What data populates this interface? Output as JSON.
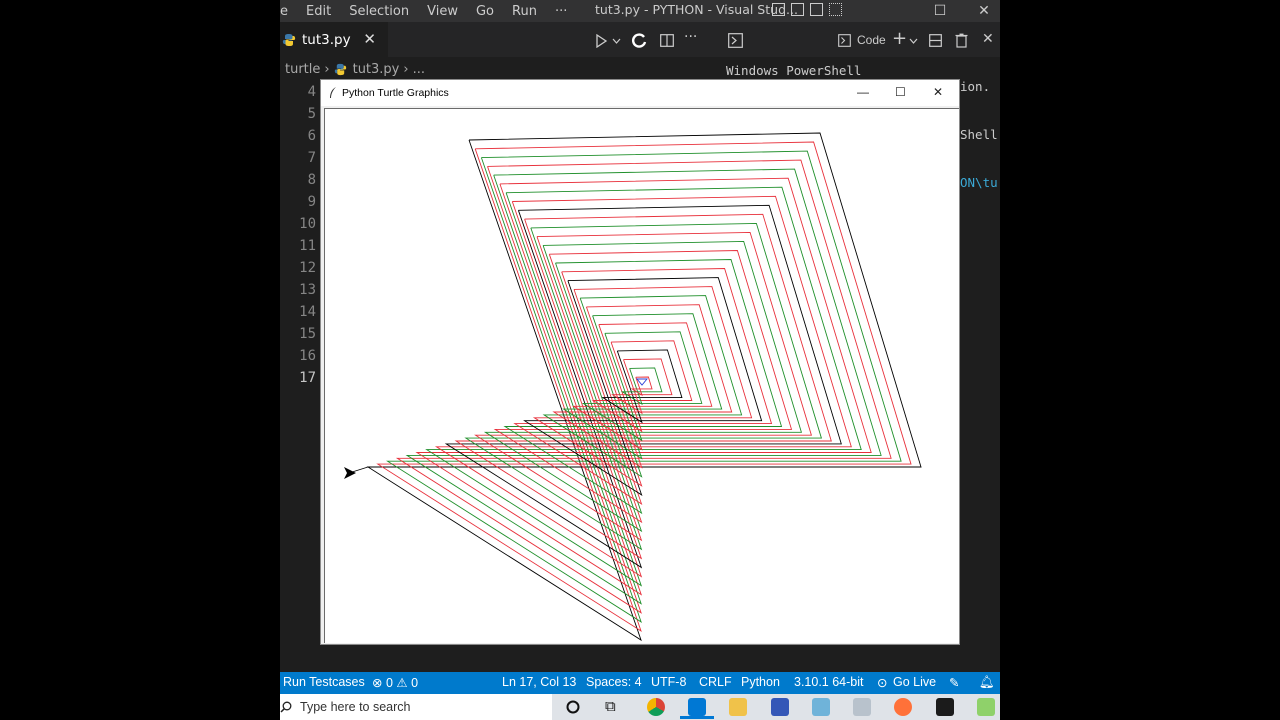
{
  "menubar": {
    "items": [
      "e",
      "Edit",
      "Selection",
      "View",
      "Go",
      "Run",
      "···"
    ],
    "title": "tut3.py - PYTHON - Visual Stud..."
  },
  "tab": {
    "label": "tut3.py",
    "close": "✕"
  },
  "toolbar": {
    "code_label": "Code",
    "more": "···"
  },
  "breadcrumb": {
    "folder": "turtle",
    "file": "tut3.py",
    "more": "..."
  },
  "editor": {
    "line_numbers": [
      "4",
      "5",
      "6",
      "7",
      "8",
      "9",
      "10",
      "11",
      "12",
      "13",
      "14",
      "15",
      "16",
      "17"
    ],
    "current_line": "17"
  },
  "terminal": {
    "heading": "Windows PowerShell",
    "lines": [
      "ion.",
      "Shell",
      "ON\\tu"
    ]
  },
  "turtle_window": {
    "title": "Python Turtle Graphics",
    "colors": [
      "#000000",
      "#e8303b",
      "#1f8f2a",
      "#e8303b",
      "#1f8f2a",
      "#e8303b",
      "#1f8f2a",
      "#e8303b"
    ]
  },
  "statusbar": {
    "run_testcases": "Run Testcases",
    "errors": "0",
    "warnings": "0",
    "position": "Ln 17, Col 13",
    "spaces": "Spaces: 4",
    "encoding": "UTF-8",
    "eol": "CRLF",
    "language": "Python",
    "interpreter": "3.10.1 64-bit",
    "golive": "Go Live"
  },
  "taskbar": {
    "search_placeholder": "Type here to search"
  }
}
